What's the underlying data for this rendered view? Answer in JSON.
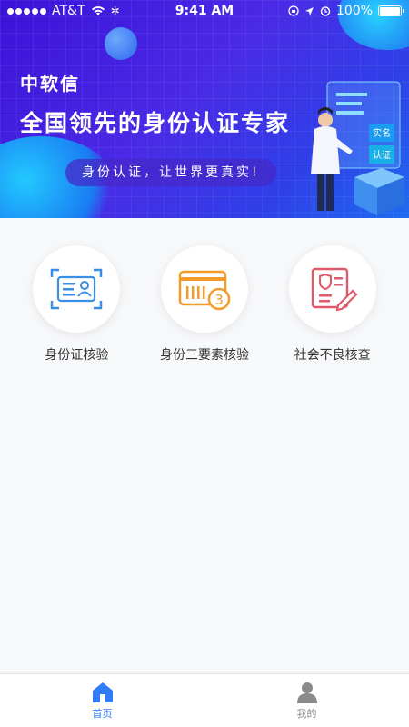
{
  "status_bar": {
    "carrier": "AT&T",
    "time": "9:41 AM",
    "battery": "100%"
  },
  "banner": {
    "brand": "中软信",
    "headline": "全国领先的身份认证专家",
    "slogan": "身份认证，让世界更真实!",
    "illustration_tags": [
      "实名",
      "认证"
    ]
  },
  "features": [
    {
      "label": "身份证核验",
      "icon": "id-card-scan-icon",
      "color": "#3a8ee6"
    },
    {
      "label": "身份三要素核验",
      "icon": "card-three-icon",
      "color": "#f39c2b"
    },
    {
      "label": "社会不良核查",
      "icon": "shield-document-icon",
      "color": "#e05a6b"
    }
  ],
  "tabbar": {
    "tabs": [
      {
        "label": "首页",
        "icon": "home-icon",
        "active": true
      },
      {
        "label": "我的",
        "icon": "user-icon",
        "active": false
      }
    ],
    "active_color": "#2f7cf6",
    "inactive_color": "#8a8a8a"
  }
}
